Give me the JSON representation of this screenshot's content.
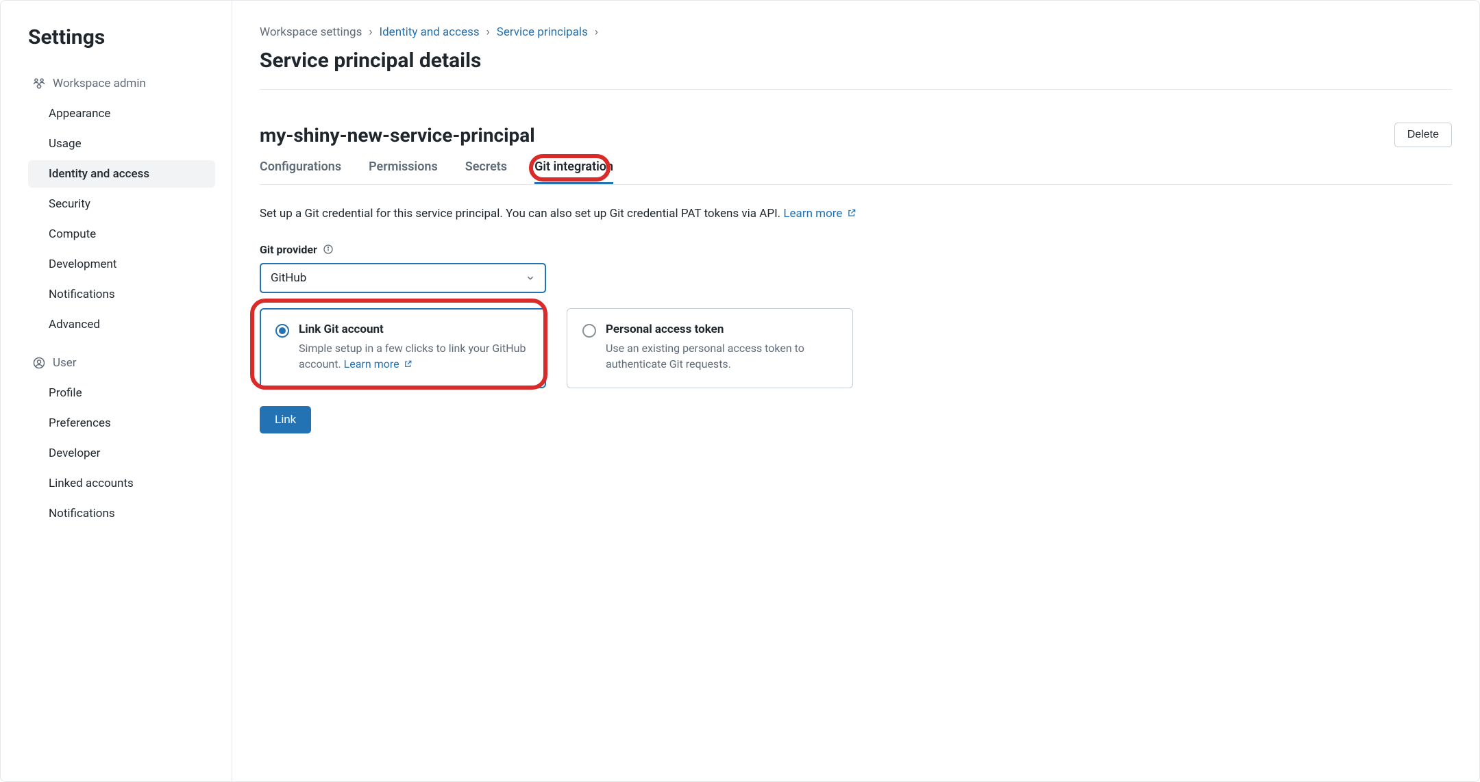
{
  "sidebar": {
    "title": "Settings",
    "groups": [
      {
        "label": "Workspace admin",
        "icon": "workspace-admin-icon",
        "items": [
          {
            "label": "Appearance",
            "active": false
          },
          {
            "label": "Usage",
            "active": false
          },
          {
            "label": "Identity and access",
            "active": true
          },
          {
            "label": "Security",
            "active": false
          },
          {
            "label": "Compute",
            "active": false
          },
          {
            "label": "Development",
            "active": false
          },
          {
            "label": "Notifications",
            "active": false
          },
          {
            "label": "Advanced",
            "active": false
          }
        ]
      },
      {
        "label": "User",
        "icon": "user-icon",
        "items": [
          {
            "label": "Profile",
            "active": false
          },
          {
            "label": "Preferences",
            "active": false
          },
          {
            "label": "Developer",
            "active": false
          },
          {
            "label": "Linked accounts",
            "active": false
          },
          {
            "label": "Notifications",
            "active": false
          }
        ]
      }
    ]
  },
  "breadcrumb": {
    "items": [
      {
        "label": "Workspace settings",
        "link": false
      },
      {
        "label": "Identity and access",
        "link": true
      },
      {
        "label": "Service principals",
        "link": true
      }
    ]
  },
  "page": {
    "title": "Service principal details",
    "entity_name": "my-shiny-new-service-principal",
    "delete_label": "Delete"
  },
  "tabs": [
    {
      "label": "Configurations",
      "active": false
    },
    {
      "label": "Permissions",
      "active": false
    },
    {
      "label": "Secrets",
      "active": false
    },
    {
      "label": "Git integration",
      "active": true
    }
  ],
  "git": {
    "description_prefix": "Set up a Git credential for this service principal. You can also set up Git credential PAT tokens via API. ",
    "learn_more": "Learn more",
    "provider_label": "Git provider",
    "provider_value": "GitHub",
    "options": [
      {
        "title": "Link Git account",
        "description_prefix": "Simple setup in a few clicks to link your GitHub account. ",
        "learn_more": "Learn more",
        "selected": true
      },
      {
        "title": "Personal access token",
        "description": "Use an existing personal access token to authenticate Git requests.",
        "selected": false
      }
    ],
    "link_button": "Link"
  }
}
